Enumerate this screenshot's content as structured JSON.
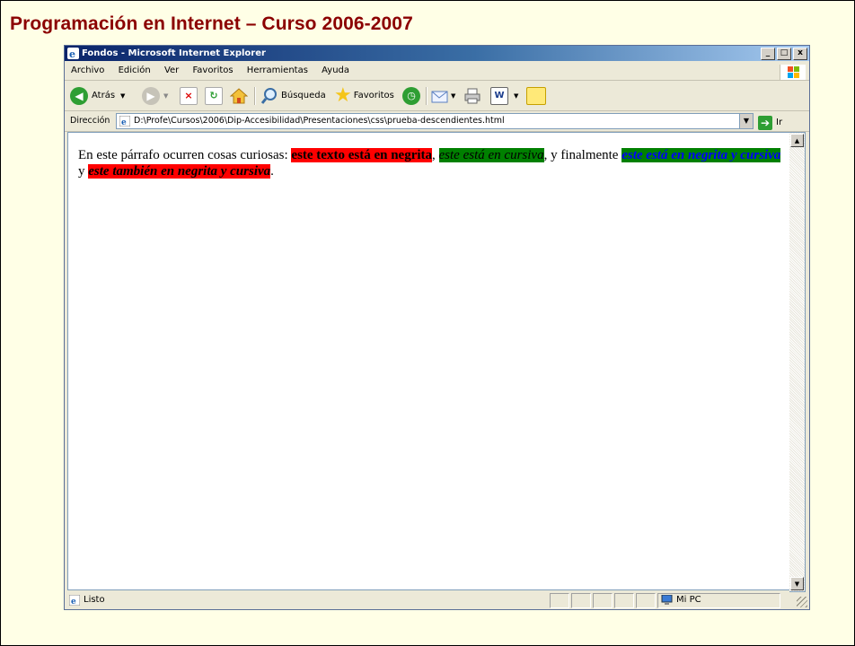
{
  "slide": {
    "title": "Programación en Internet – Curso 2006-2007",
    "colors": {
      "background": "#ffffe6",
      "title": "#8b0000"
    }
  },
  "window": {
    "title": "Fondos - Microsoft Internet Explorer",
    "buttons": {
      "minimize": "_",
      "maximize": "□",
      "close": "x"
    }
  },
  "menu": {
    "items": [
      "Archivo",
      "Edición",
      "Ver",
      "Favoritos",
      "Herramientas",
      "Ayuda"
    ]
  },
  "toolbar": {
    "back_label": "Atrás",
    "search_label": "Búsqueda",
    "favorites_label": "Favoritos"
  },
  "address": {
    "label": "Dirección",
    "value": "D:\\Profe\\Cursos\\2006\\Dip-Accesibilidad\\Presentaciones\\css\\prueba-descendientes.html",
    "go_label": "Ir"
  },
  "page": {
    "segments": {
      "s1": "En este párrafo ocurren cosas curiosas: ",
      "s2": "este texto está en negrita",
      "s3": ", ",
      "s4": "este está en cursiva",
      "s5": ", y finalmente ",
      "s6": "este está en negrita y cursiva",
      "s7": " y ",
      "s8": "este también en negrita y cursiva",
      "s9": "."
    },
    "colors": {
      "red": "#ff0000",
      "green": "#008000",
      "blue": "#0000ff"
    }
  },
  "status": {
    "text": "Listo",
    "zone": "Mi PC"
  }
}
